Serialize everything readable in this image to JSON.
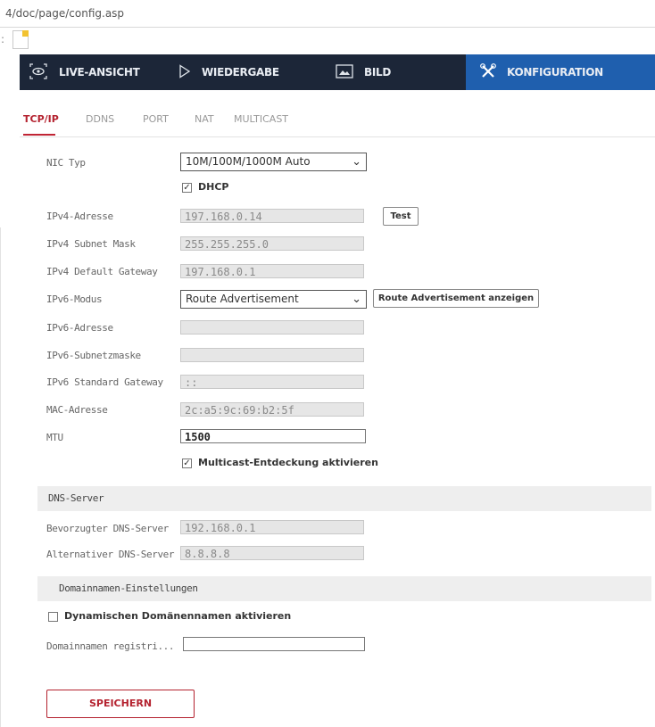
{
  "browser": {
    "url": "4/doc/page/config.asp"
  },
  "nav": {
    "items": [
      {
        "label": "LIVE-ANSICHT",
        "icon": "eye-icon"
      },
      {
        "label": "WIEDERGABE",
        "icon": "play-icon"
      },
      {
        "label": "BILD",
        "icon": "image-icon"
      },
      {
        "label": "KONFIGURATION",
        "icon": "tools-icon"
      }
    ],
    "active": "KONFIGURATION",
    "colors": {
      "bar": "#1c2638",
      "active": "#1f5fae"
    }
  },
  "subtabs": [
    "TCP/IP",
    "DDNS",
    "PORT",
    "NAT",
    "MULTICAST"
  ],
  "accent_color": "#c02434",
  "form": {
    "nic": {
      "label": "NIC Typ",
      "value": "10M/100M/1000M Auto"
    },
    "dhcp": {
      "label": "DHCP",
      "checked": true
    },
    "ipv4_address": {
      "label": "IPv4-Adresse",
      "value": "197.168.0.14",
      "test_button": "Test"
    },
    "ipv4_mask": {
      "label": "IPv4 Subnet Mask",
      "value": "255.255.255.0"
    },
    "ipv4_gateway": {
      "label": "IPv4 Default Gateway",
      "value": "197.168.0.1"
    },
    "ipv6_mode": {
      "label": "IPv6-Modus",
      "value": "Route Advertisement",
      "button": "Route Advertisement anzeigen"
    },
    "ipv6_address": {
      "label": "IPv6-Adresse",
      "value": ""
    },
    "ipv6_subnet": {
      "label": "IPv6-Subnetzmaske",
      "value": ""
    },
    "ipv6_gateway": {
      "label": "IPv6 Standard Gateway",
      "value": "::"
    },
    "mac": {
      "label": "MAC-Adresse",
      "value": "2c:a5:9c:69:b2:5f"
    },
    "mtu": {
      "label": "MTU",
      "value": "1500"
    },
    "multicast": {
      "label": "Multicast-Entdeckung aktivieren",
      "checked": true
    }
  },
  "dns": {
    "header": "DNS-Server",
    "preferred": {
      "label": "Bevorzugter DNS-Server",
      "value": "192.168.0.1"
    },
    "alternate": {
      "label": "Alternativer DNS-Server",
      "value": "8.8.8.8"
    }
  },
  "domain": {
    "header": "Domainnamen-Einstellungen",
    "dynamic": {
      "label": "Dynamischen Domänennamen aktivieren",
      "checked": false
    },
    "register": {
      "label": "Domainnamen registri...",
      "value": ""
    }
  },
  "save_label": "SPEICHERN"
}
